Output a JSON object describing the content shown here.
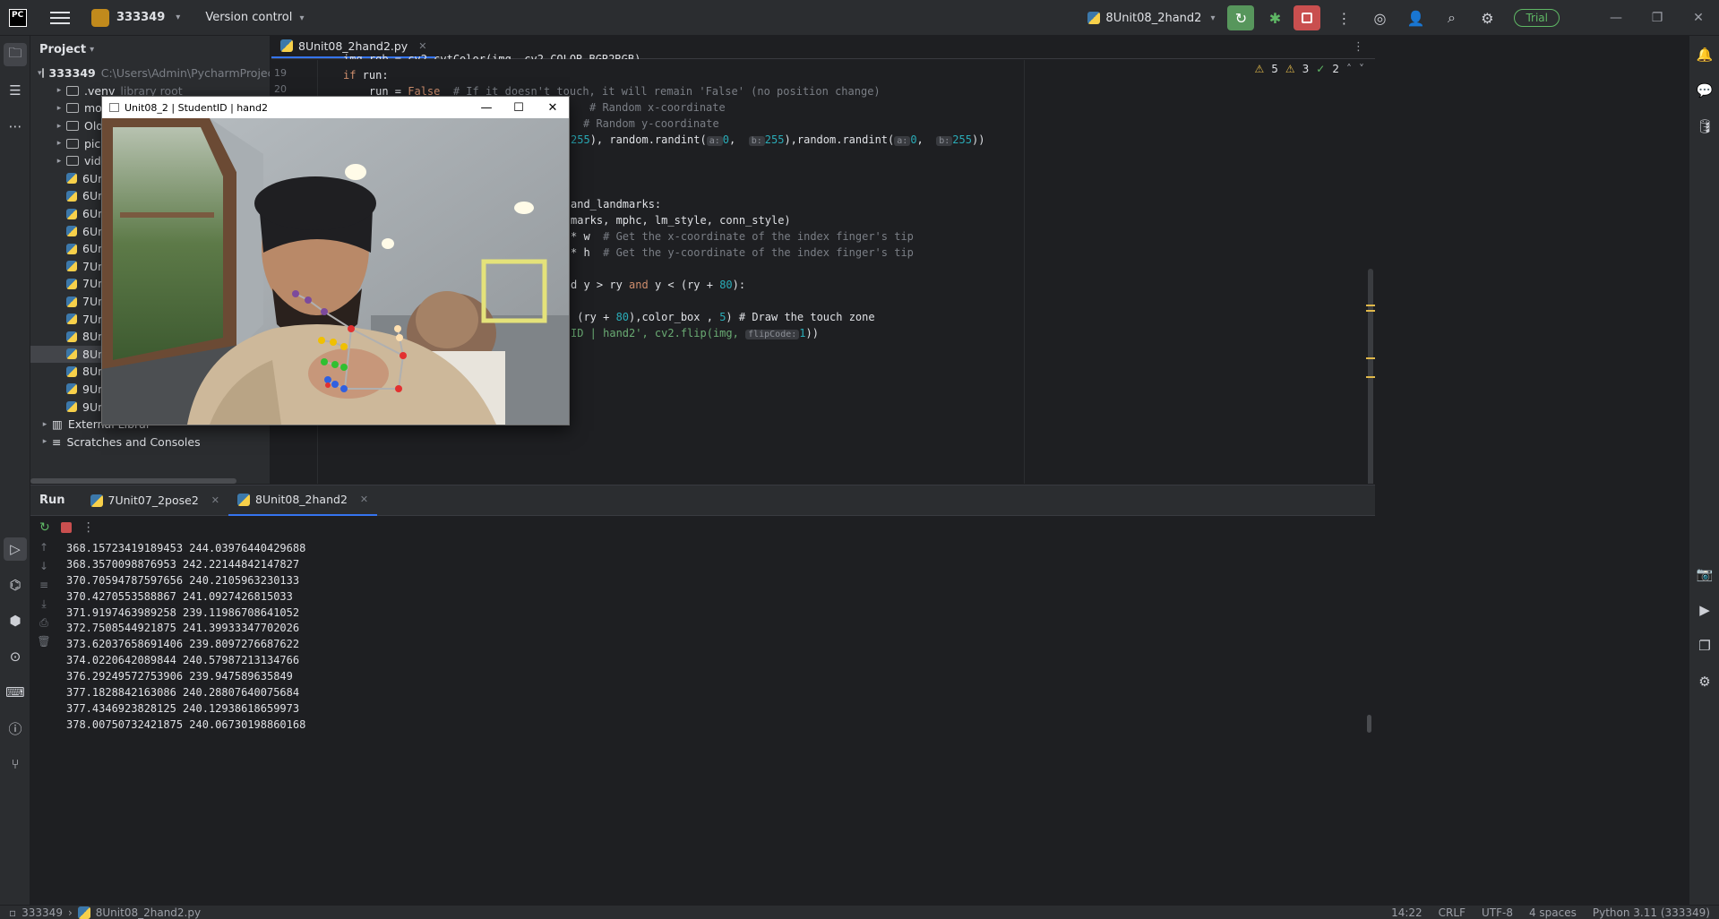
{
  "titlebar": {
    "logo": "PC",
    "project_name": "333349",
    "version_control": "Version control",
    "run_config": "8Unit08_2hand2",
    "trial": "Trial"
  },
  "project_panel": {
    "title": "Project",
    "root_name": "333349",
    "root_path": "C:\\Users\\Admin\\PycharmProjects\\3",
    "items": [
      {
        "label": ".venv",
        "hint": "library root",
        "type": "folder"
      },
      {
        "label": "mod",
        "type": "folder"
      },
      {
        "label": "OldP",
        "type": "folder"
      },
      {
        "label": "pic",
        "type": "folder"
      },
      {
        "label": "vide",
        "type": "folder"
      },
      {
        "label": "6Un",
        "type": "file"
      },
      {
        "label": "6Un",
        "type": "file"
      },
      {
        "label": "6Un",
        "type": "file"
      },
      {
        "label": "6Un",
        "type": "file"
      },
      {
        "label": "6Un",
        "type": "file"
      },
      {
        "label": "7Un",
        "type": "file"
      },
      {
        "label": "7Un",
        "type": "file"
      },
      {
        "label": "7Un",
        "type": "file"
      },
      {
        "label": "7Un",
        "type": "file"
      },
      {
        "label": "8Un",
        "type": "file"
      },
      {
        "label": "8Un",
        "type": "file"
      },
      {
        "label": "8Un",
        "type": "file"
      },
      {
        "label": "9Un",
        "type": "file"
      },
      {
        "label": "9Un",
        "type": "file"
      }
    ],
    "external": "External Librar",
    "scratches": "Scratches and Consoles"
  },
  "editor": {
    "tab": "8Unit08_2hand2.py",
    "inspections": {
      "warn1": "5",
      "warn2": "3",
      "check": "2"
    },
    "line_numbers": [
      "19",
      "20"
    ],
    "lines": {
      "l0": "img_rgb = cv2.cvtColor(img, cv2.COLOR_BGR2RGB)",
      "l1_kw": "if",
      "l1_rest": " run:",
      "l2_a": "    run = ",
      "l2_kw": "False",
      "l2_cm": "  # If it doesn't touch, it will remain 'False' (no position change)",
      "l3": "# Random x-coordinate",
      "l4": "# Random y-coordinate",
      "l5_a": "255",
      "l5_b": "), random.randint(",
      "l5_h1": "a:",
      "l5_c": "0",
      "l5_d": ",  ",
      "l5_h2": "b:",
      "l5_e": "255",
      "l5_f": "),random.randint(",
      "l5_h3": "a:",
      "l5_g": "0",
      "l5_h": ",  ",
      "l5_h4": "b:",
      "l5_i": "255",
      "l5_j": "))",
      "l6": "and_landmarks:",
      "l7": "marks, mphc, lm_style, conn_style)",
      "l8_a": "* w  ",
      "l8_cm": "# Get the x-coordinate of the index finger's tip",
      "l9_a": "* h  ",
      "l9_cm": "# Get the y-coordinate of the index finger's tip",
      "l10_a": "d y > ry ",
      "l10_kw": "and",
      "l10_b": " y < (ry + ",
      "l10_n": "80",
      "l10_c": "):",
      "l11_a": " (ry + ",
      "l11_n": "80",
      "l11_b": "),color_box , ",
      "l11_n2": "5",
      "l11_c": ") # Draw the touch zone",
      "l12_a": "ID | hand2', cv2.flip(img, ",
      "l12_h": "flipCode:",
      "l12_n": "1",
      "l12_b": "))"
    }
  },
  "camera_window": {
    "title": "Unit08_2 | StudentID | hand2",
    "colors": {
      "box": "#e4e27a"
    }
  },
  "run_panel": {
    "title": "Run",
    "tabs": [
      {
        "label": "7Unit07_2pose2"
      },
      {
        "label": "8Unit08_2hand2"
      }
    ],
    "output": [
      "368.15723419189453 244.03976440429688",
      "368.3570098876953 242.22144842147827",
      "370.70594787597656 240.2105963230133",
      "370.4270553588867 241.0927426815033",
      "371.9197463989258 239.11986708641052",
      "372.7508544921875 241.39933347702026",
      "373.62037658691406 239.8097276687622",
      "374.0220642089844 240.57987213134766",
      "376.29249572753906 239.947589635849",
      "377.1828842163086 240.28807640075684",
      "377.4346923828125 240.12938618659973",
      "378.00750732421875 240.06730198860168"
    ]
  },
  "statusbar": {
    "project": "333349",
    "file": "8Unit08_2hand2.py",
    "position": "14:22",
    "line_sep": "CRLF",
    "encoding": "UTF-8",
    "indent": "4 spaces",
    "interpreter": "Python 3.11 (333349)"
  }
}
